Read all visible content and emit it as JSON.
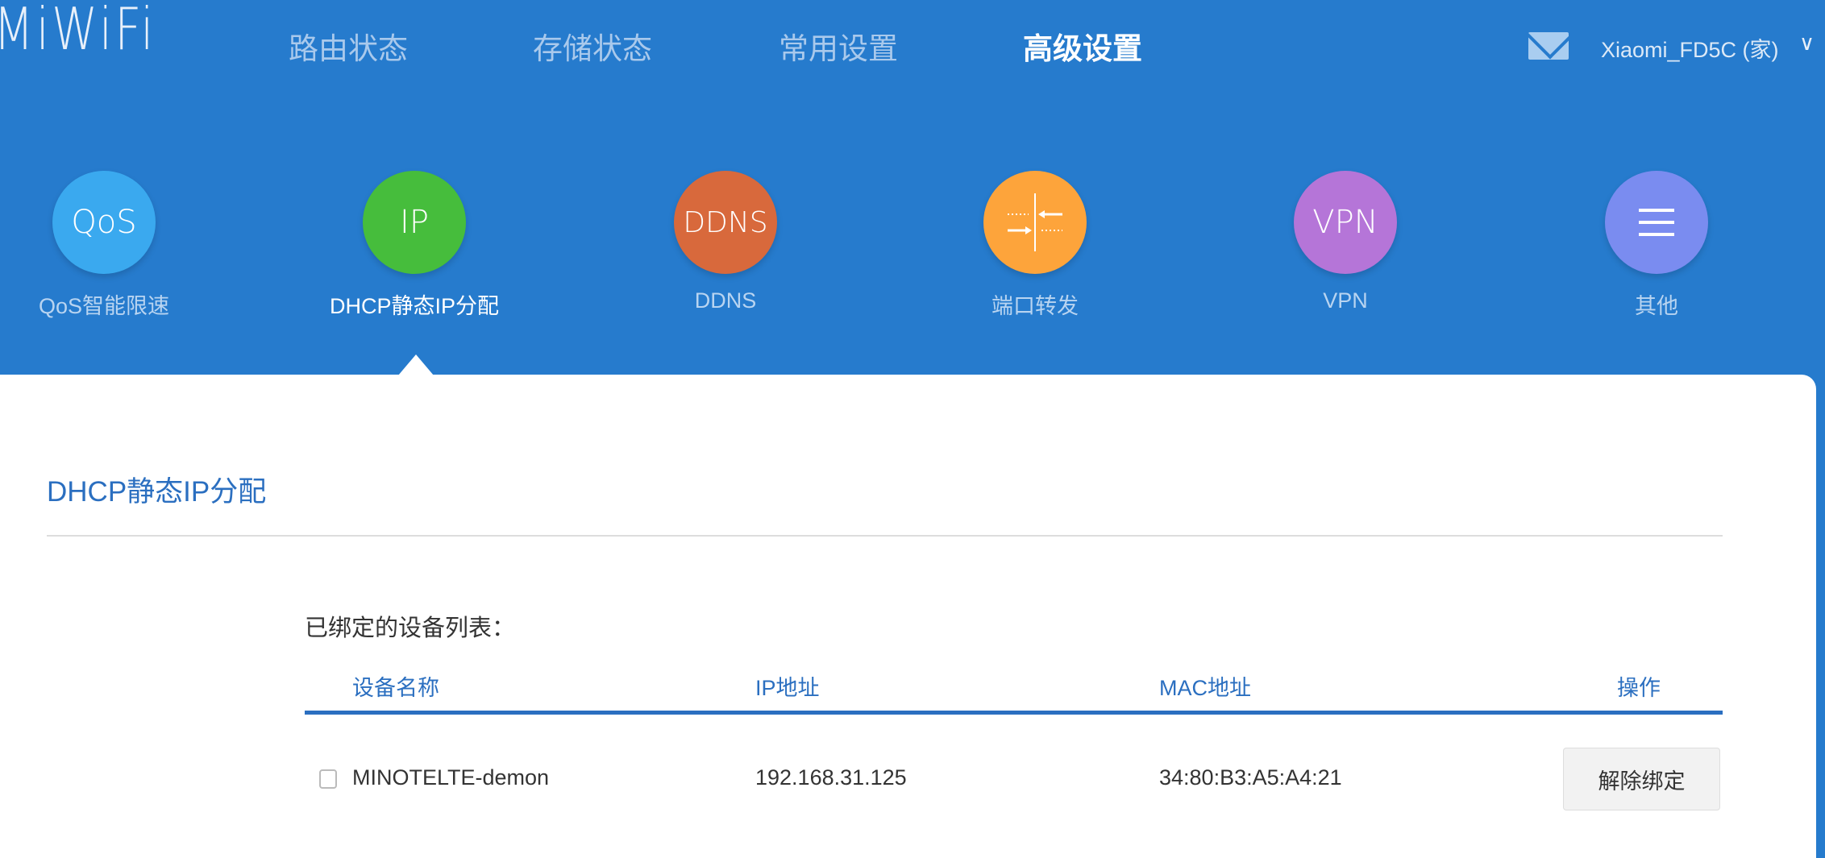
{
  "logo": "MiWiFi",
  "nav": [
    {
      "label": "路由状态"
    },
    {
      "label": "存储状态"
    },
    {
      "label": "常用设置"
    },
    {
      "label": "高级设置",
      "active": true
    }
  ],
  "account": {
    "name": "Xiaomi_FD5C (家)",
    "chevron": "∨"
  },
  "icons": [
    {
      "glyph": "QoS",
      "label": "QoS智能限速",
      "color": "#3aa9ef"
    },
    {
      "glyph": "IP",
      "label": "DHCP静态IP分配",
      "color": "#46bd3c",
      "active": true
    },
    {
      "glyph": "DDNS",
      "label": "DDNS",
      "color": "#d8693c"
    },
    {
      "glyph": "",
      "label": "端口转发",
      "color": "#fda43b"
    },
    {
      "glyph": "VPN",
      "label": "VPN",
      "color": "#b575d8"
    },
    {
      "glyph": "",
      "label": "其他",
      "color": "#7a8cf0"
    }
  ],
  "page": {
    "title": "DHCP静态IP分配",
    "subtitle": "已绑定的设备列表："
  },
  "table": {
    "headers": [
      "设备名称",
      "IP地址",
      "MAC地址",
      "操作"
    ],
    "rows": [
      {
        "name": "MINOTELTE-demon",
        "ip": "192.168.31.125",
        "mac": "34:80:B3:A5:A4:21",
        "action": "解除绑定"
      }
    ]
  }
}
